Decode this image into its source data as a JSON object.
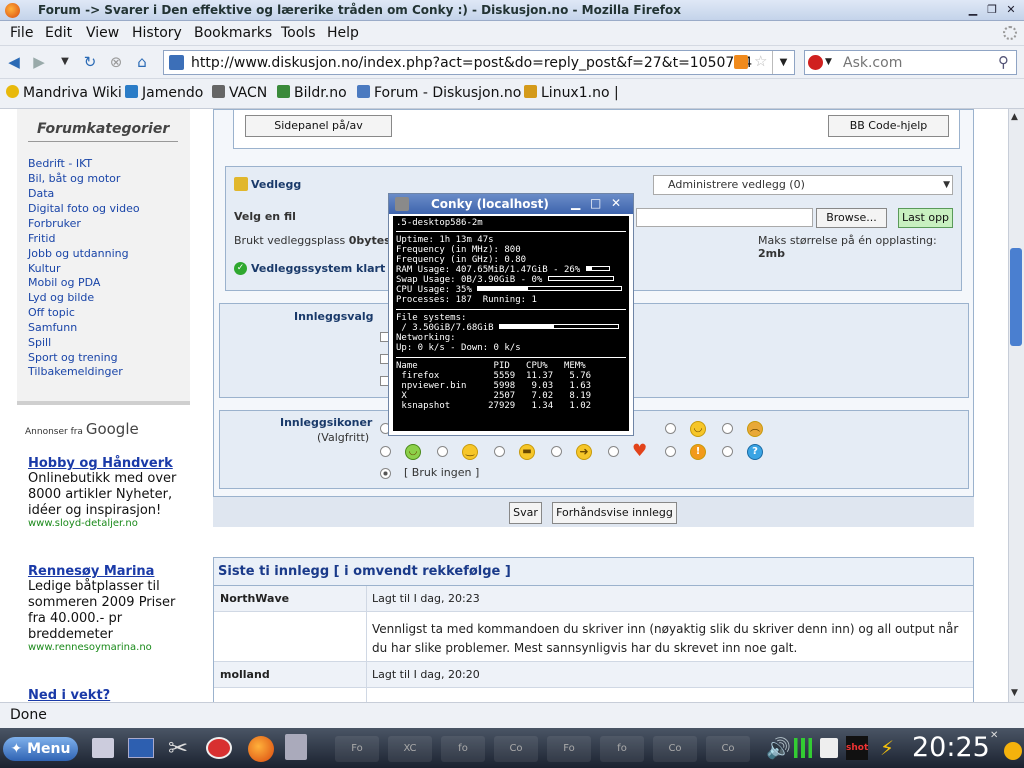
{
  "window": {
    "title": "Forum -> Svarer i Den effektive og lærerike tråden om Conky :) - Diskusjon.no - Mozilla Firefox"
  },
  "menu": [
    "File",
    "Edit",
    "View",
    "History",
    "Bookmarks",
    "Tools",
    "Help"
  ],
  "nav": {
    "url": "http://www.diskusjon.no/index.php?act=post&do=reply_post&f=27&t=1050704",
    "search_placeholder": "Ask.com"
  },
  "bookmarks": [
    {
      "label": "Mandriva Wiki",
      "color": "#e8b90c"
    },
    {
      "label": "Jamendo",
      "color": "#2a7cc7"
    },
    {
      "label": "VACN",
      "color": "#666666"
    },
    {
      "label": "Bildr.no",
      "color": "#3a8a3a"
    },
    {
      "label": "Forum - Diskusjon.no",
      "color": "#4b7ac0"
    },
    {
      "label": "Linux1.no |",
      "color": "#d49a1a"
    }
  ],
  "sidebar": {
    "heading": "Forumkategorier",
    "categories": [
      "Bedrift - IKT",
      "Bil, båt og motor",
      "Data",
      "Digital foto og video",
      "Forbruker",
      "Fritid",
      "Jobb og utdanning",
      "Kultur",
      "Mobil og PDA",
      "Lyd og bilde",
      "Off topic",
      "Samfunn",
      "Spill",
      "Sport og trening",
      "Tilbakemeldinger"
    ]
  },
  "ads": {
    "label": "Annonser fra",
    "brand": "Google",
    "items": [
      {
        "title": "Hobby og Håndverk",
        "body": "Onlinebutikk med over 8000 artikler Nyheter, idéer og inspirasjon!",
        "url": "www.sloyd-detaljer.no"
      },
      {
        "title": "Rennesøy Marina",
        "body": "Ledige båtplasser til sommeren 2009 Priser fra 40.000.- pr breddemeter",
        "url": "www.rennesoymarina.no"
      },
      {
        "title": "Ned i vekt?"
      }
    ]
  },
  "editor": {
    "sidepanel": "Sidepanel på/av",
    "bbcode": "BB Code-hjelp"
  },
  "attach": {
    "title": "Vedlegg",
    "manage": "Administrere vedlegg (0)",
    "choose_label": "Velg en fil",
    "browse": "Browse...",
    "upload": "Last opp",
    "used_label": "Brukt vedleggsplass",
    "used_value": "0bytes",
    "max_label": "Maks størrelse på én opplasting:",
    "max_value": "2mb",
    "system_ok": "Vedleggssystem klart"
  },
  "options": {
    "title": "Innleggsvalg"
  },
  "icons": {
    "title": "Innleggsikoner",
    "subtitle": "(Valgfritt)",
    "none": "[ Bruk ingen ]"
  },
  "actions": {
    "reply": "Svar",
    "preview": "Forhåndsvise innlegg"
  },
  "recent": {
    "title": "Siste ti innlegg [ i omvendt rekkefølge ]",
    "posts": [
      {
        "author": "NorthWave",
        "time": "Lagt til I dag, 20:23",
        "text": "Vennligst ta med kommandoen du skriver inn (nøyaktig slik du skriver denn inn) og all output når du har slike problemer. Mest sannsynligvis har du skrevet inn noe galt."
      },
      {
        "author": "molland",
        "time": "Lagt til I dag, 20:20"
      }
    ]
  },
  "conky": {
    "title": "Conky (localhost)",
    "kernel": ".5-desktop586-2m",
    "uptime": "Uptime: 1h 13m 47s",
    "freq_mhz": "Frequency (in MHz): 800",
    "freq_ghz": "Frequency (in GHz): 0.80",
    "ram": "RAM Usage: 407.65MiB/1.47GiB - 26%",
    "ram_frac": 0.26,
    "swap": "Swap Usage: 0B/3.90GiB - 0%",
    "swap_frac": 0,
    "cpu": "CPU Usage: 35%",
    "cpu_frac": 0.35,
    "procs": "Processes: 187  Running: 1",
    "fs_label": "File systems:",
    "fs_root": " / 3.50GiB/7.68GiB",
    "fs_frac": 0.46,
    "net_label": "Networking:",
    "net": "Up: 0 k/s - Down: 0 k/s",
    "proc_header": "Name              PID   CPU%   MEM%",
    "procs_list": [
      " firefox          5559  11.37   5.76",
      " npviewer.bin     5998   9.03   1.63",
      " X                2507   7.02   8.19",
      " ksnapshot       27929   1.34   1.02"
    ]
  },
  "status": "Done",
  "taskbar": {
    "menu": "Menu",
    "clock": "20:25",
    "tray": "shot"
  }
}
